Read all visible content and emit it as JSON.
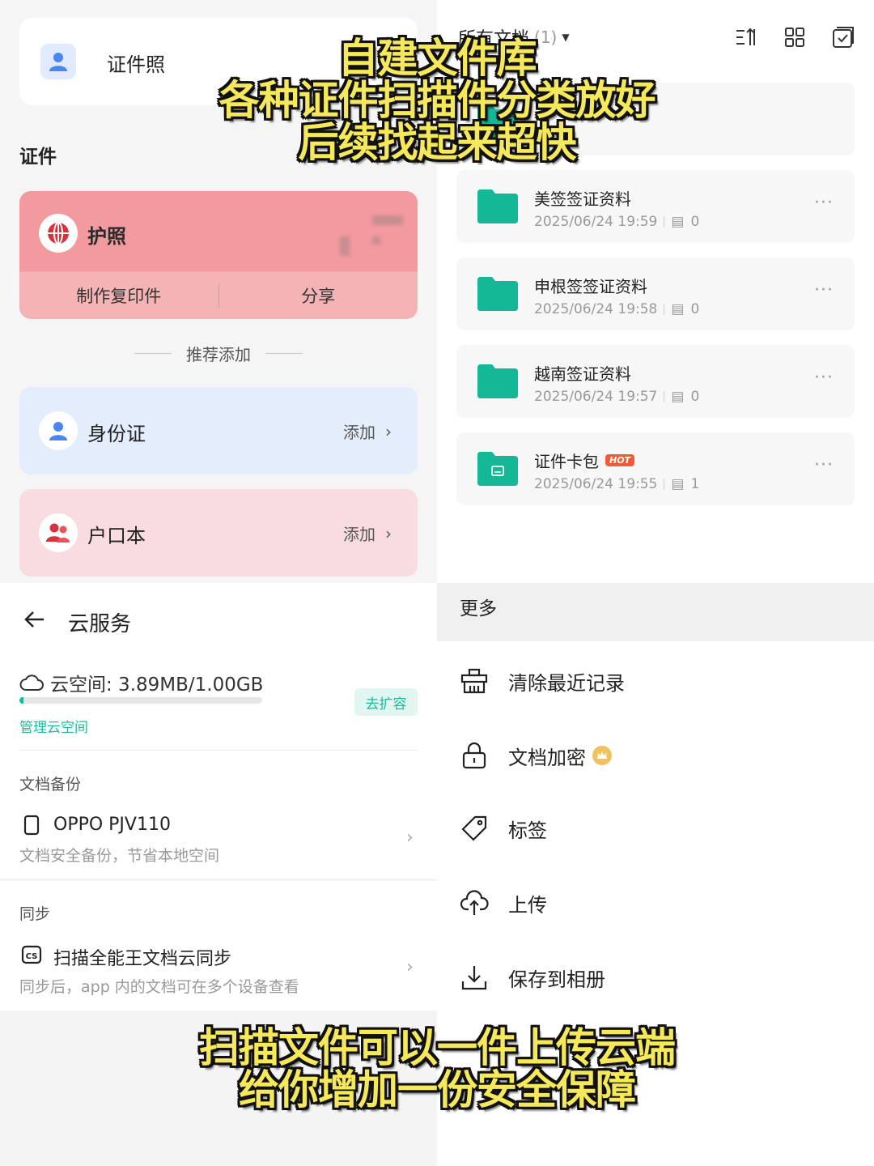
{
  "id_photos": {
    "card_label": "证件照",
    "section_title": "证件",
    "passport": {
      "label": "护照",
      "actions": [
        "制作复印件",
        "分享"
      ]
    },
    "recommend_label": "推荐添加",
    "suggestions": [
      {
        "name": "身份证",
        "action": "添加",
        "icon": "person-icon"
      },
      {
        "name": "户口本",
        "action": "添加",
        "icon": "family-icon"
      }
    ]
  },
  "documents": {
    "header_title": "所有文档",
    "header_count": "(1)",
    "toolbar_icons": [
      "sort-icon",
      "grid-view-icon",
      "select-all-icon"
    ],
    "folders": [
      {
        "name": "美签签证资料",
        "date": "2025/06/24 19:59",
        "count": "0",
        "hot": false
      },
      {
        "name": "申根签签证资料",
        "date": "2025/06/24 19:58",
        "count": "0",
        "hot": false
      },
      {
        "name": "越南签证资料",
        "date": "2025/06/24 19:57",
        "count": "0",
        "hot": false
      },
      {
        "name": "证件卡包",
        "date": "2025/06/24 19:55",
        "count": "1",
        "hot": true,
        "hot_label": "HOT"
      }
    ],
    "more_glyph": "···"
  },
  "cloud": {
    "title": "云服务",
    "space_label": "云空间: 3.89MB/1.00GB",
    "usage_fraction": 0.0038,
    "expand_button": "去扩容",
    "manage_link": "管理云空间",
    "backup": {
      "heading": "文档备份",
      "device": "OPPO PJV110",
      "desc": "文档安全备份，节省本地空间"
    },
    "sync": {
      "heading": "同步",
      "title": "扫描全能王文档云同步",
      "desc": "同步后，app 内的文档可在多个设备查看"
    }
  },
  "more_menu": {
    "title": "更多",
    "items": [
      {
        "label": "清除最近记录",
        "icon": "clear-history-icon"
      },
      {
        "label": "文档加密",
        "icon": "lock-icon",
        "vip": true
      },
      {
        "label": "标签",
        "icon": "tag-icon"
      },
      {
        "label": "上传",
        "icon": "upload-cloud-icon"
      },
      {
        "label": "保存到相册",
        "icon": "download-icon"
      }
    ]
  },
  "captions": {
    "top": [
      "自建文件库",
      "各种证件扫描件分类放好",
      "后续找起来超快"
    ],
    "bottom": [
      "扫描文件可以一件上传云端",
      "给你增加一份安全保障"
    ]
  },
  "colors": {
    "accent": "#19bc9c",
    "passport_bg": "#f29a9d",
    "caption_fill": "#f5e85a",
    "hot_badge": "#f45a3a"
  }
}
